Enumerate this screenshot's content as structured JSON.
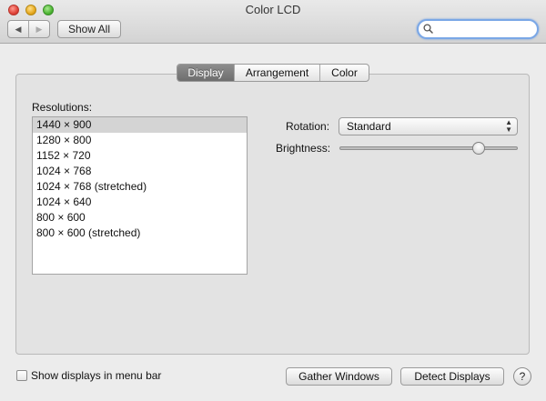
{
  "window": {
    "title": "Color LCD"
  },
  "toolbar": {
    "back_glyph": "◀",
    "forward_glyph": "▶",
    "show_all_label": "Show All",
    "search": {
      "value": "",
      "placeholder": ""
    }
  },
  "tabs": [
    {
      "label": "Display",
      "active": true
    },
    {
      "label": "Arrangement",
      "active": false
    },
    {
      "label": "Color",
      "active": false
    }
  ],
  "resolutions": {
    "label": "Resolutions:",
    "items": [
      "1440 × 900",
      "1280 × 800",
      "1152 × 720",
      "1024 × 768",
      "1024 × 768 (stretched)",
      "1024 × 640",
      "800 × 600",
      "800 × 600 (stretched)"
    ],
    "selected_index": 0
  },
  "rotation": {
    "label": "Rotation:",
    "value": "Standard"
  },
  "brightness": {
    "label": "Brightness:",
    "level_percent": 78
  },
  "footer": {
    "show_in_menu_bar_label": "Show displays in menu bar",
    "show_in_menu_bar_checked": false,
    "gather_label": "Gather Windows",
    "detect_label": "Detect Displays",
    "help_glyph": "?"
  },
  "icons": {
    "close": "close-button-icon",
    "minimize": "minimize-button-icon",
    "maximize": "zoom-button-icon",
    "search": "magnifier-icon"
  },
  "colors": {
    "tab_active_bg": "#7d7d7d",
    "search_focus_ring": "#7aa7e6",
    "selected_row_bg": "#d4d4d4"
  }
}
